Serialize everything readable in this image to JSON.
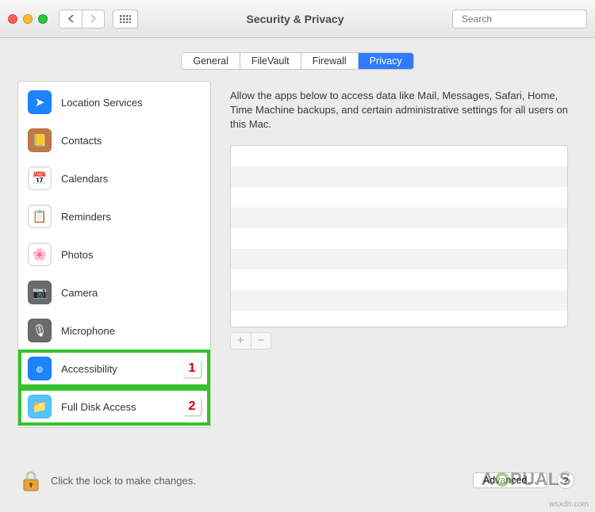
{
  "window": {
    "title": "Security & Privacy"
  },
  "search": {
    "placeholder": "Search"
  },
  "tabs": {
    "items": [
      {
        "label": "General"
      },
      {
        "label": "FileVault"
      },
      {
        "label": "Firewall"
      },
      {
        "label": "Privacy"
      }
    ],
    "activeIndex": 3
  },
  "sidebar": {
    "items": [
      {
        "label": "Location Services",
        "iconName": "location-icon",
        "bg": "#1e83ff",
        "glyph": "➤"
      },
      {
        "label": "Contacts",
        "iconName": "contacts-icon",
        "bg": "#c07a48",
        "glyph": "📒"
      },
      {
        "label": "Calendars",
        "iconName": "calendar-icon",
        "bg": "#ffffff",
        "glyph": "📅"
      },
      {
        "label": "Reminders",
        "iconName": "reminders-icon",
        "bg": "#ffffff",
        "glyph": "📋"
      },
      {
        "label": "Photos",
        "iconName": "photos-icon",
        "bg": "#ffffff",
        "glyph": "🌸"
      },
      {
        "label": "Camera",
        "iconName": "camera-icon",
        "bg": "#6b6b6b",
        "glyph": "📷"
      },
      {
        "label": "Microphone",
        "iconName": "microphone-icon",
        "bg": "#6b6b6b",
        "glyph": "🎙"
      },
      {
        "label": "Accessibility",
        "iconName": "accessibility-icon",
        "bg": "#1e83ff",
        "glyph": "๏",
        "annot": "1"
      },
      {
        "label": "Full Disk Access",
        "iconName": "folder-icon",
        "bg": "#55c4ff",
        "glyph": "📁",
        "annot": "2"
      }
    ]
  },
  "right": {
    "description": "Allow the apps below to access data like Mail, Messages, Safari, Home, Time Machine backups, and certain administrative settings for all users on this Mac."
  },
  "footer": {
    "lockText": "Click the lock to make changes.",
    "advanced": "Advanced…"
  },
  "attribution": "wsxdn.com",
  "brand": "APPUALS"
}
